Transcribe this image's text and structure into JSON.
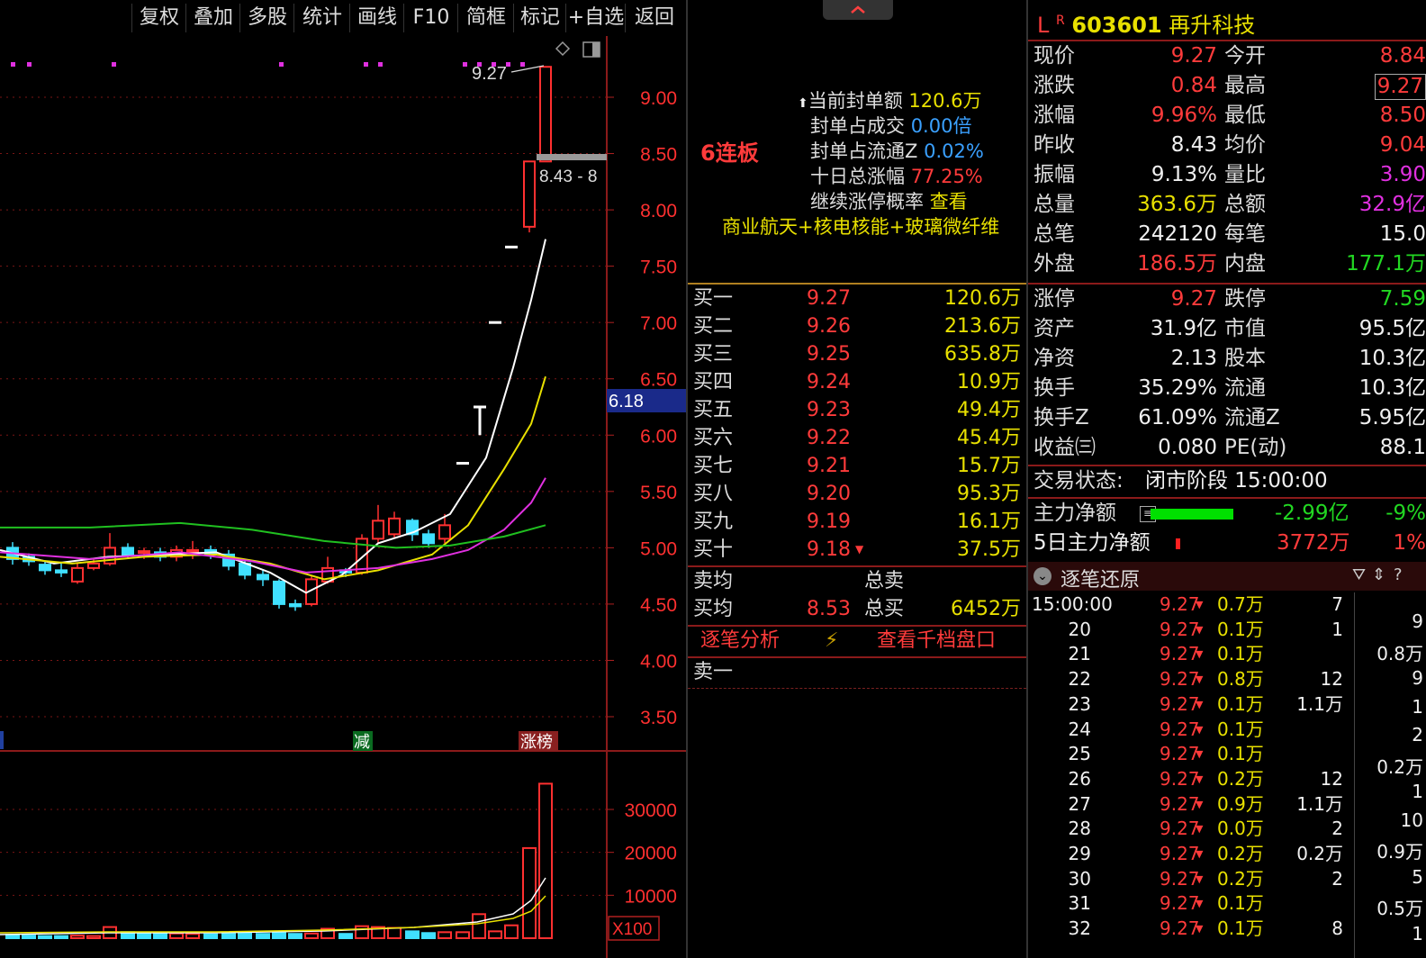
{
  "toolbar": {
    "buttons": [
      "复权",
      "叠加",
      "多股",
      "统计",
      "画线",
      "F10",
      "简框",
      "标记",
      "+自选",
      "返回"
    ]
  },
  "chart": {
    "price_labels": [
      "9.00",
      "8.50",
      "8.00",
      "7.50",
      "7.00",
      "6.50",
      "6.00",
      "5.50",
      "5.00",
      "4.50",
      "4.00",
      "3.50"
    ],
    "high_marker": "9.27",
    "range_tag": "8.43 - 8",
    "current_price_tag": "6.18",
    "badge_reduce": "减",
    "badge_rank": "涨榜",
    "volume_labels": [
      "30000",
      "20000",
      "10000"
    ],
    "volume_unit": "X100",
    "colors": {
      "up": "#ff3030",
      "down": "#40e0ff",
      "ma5": "#ffffff",
      "ma10": "#e8e000",
      "ma20": "#e030e0",
      "ma60": "#20c020"
    }
  },
  "chart_data": {
    "type": "candlestick",
    "price_axis": [
      3.5,
      9.0
    ],
    "volume_axis": [
      0,
      30000
    ],
    "volume_unit": "X100",
    "last_candles": [
      {
        "open": 7.85,
        "close": 8.43,
        "high": 8.43,
        "low": 7.85
      },
      {
        "open": 8.43,
        "close": 9.27,
        "high": 9.27,
        "low": 8.43
      }
    ]
  },
  "board": {
    "streak": "6连板",
    "seal_amount_label": "当前封单额",
    "seal_amount": "120.6万",
    "seal_vs_turnover_label": "封单占成交",
    "seal_vs_turnover": "0.00倍",
    "seal_vs_float_label": "封单占流通Z",
    "seal_vs_float": "0.02%",
    "ten_day_label": "十日总涨幅",
    "ten_day": "77.25%",
    "continue_label": "继续涨停概率",
    "continue_link": "查看",
    "concepts": "商业航天+核电核能+玻璃微纤维"
  },
  "order_book": {
    "bids": [
      {
        "label": "买一",
        "price": "9.27",
        "vol": "120.6万"
      },
      {
        "label": "买二",
        "price": "9.26",
        "vol": "213.6万"
      },
      {
        "label": "买三",
        "price": "9.25",
        "vol": "635.8万"
      },
      {
        "label": "买四",
        "price": "9.24",
        "vol": "10.9万"
      },
      {
        "label": "买五",
        "price": "9.23",
        "vol": "49.4万"
      },
      {
        "label": "买六",
        "price": "9.22",
        "vol": "45.4万"
      },
      {
        "label": "买七",
        "price": "9.21",
        "vol": "15.7万"
      },
      {
        "label": "买八",
        "price": "9.20",
        "vol": "95.3万"
      },
      {
        "label": "买九",
        "price": "9.19",
        "vol": "16.1万"
      },
      {
        "label": "买十",
        "price": "9.18",
        "vol": "37.5万"
      }
    ],
    "sell_avg_label": "卖均",
    "total_sell_label": "总卖",
    "buy_avg_label": "买均",
    "buy_avg": "8.53",
    "total_buy_label": "总买",
    "total_buy": "6452万",
    "tick_analysis": "逐笔分析",
    "thousand_levels": "查看千档盘口",
    "ask_one": "卖一"
  },
  "quote": {
    "flag_l": "L",
    "flag_r": "R",
    "code": "603601",
    "name": "再升科技",
    "rows": [
      {
        "l1": "现价",
        "v1": "9.27",
        "l2": "今开",
        "v2": "8.84"
      },
      {
        "l1": "涨跌",
        "v1": "0.84",
        "l2": "最高",
        "v2": "9.27"
      },
      {
        "l1": "涨幅",
        "v1": "9.96%",
        "l2": "最低",
        "v2": "8.50"
      },
      {
        "l1": "昨收",
        "v1": "8.43",
        "l2": "均价",
        "v2": "9.04"
      },
      {
        "l1": "振幅",
        "v1": "9.13%",
        "l2": "量比",
        "v2": "3.90"
      },
      {
        "l1": "总量",
        "v1": "363.6万",
        "l2": "总额",
        "v2": "32.9亿"
      },
      {
        "l1": "总笔",
        "v1": "242120",
        "l2": "每笔",
        "v2": "15.0"
      },
      {
        "l1": "外盘",
        "v1": "186.5万",
        "l2": "内盘",
        "v2": "177.1万"
      }
    ],
    "rows2": [
      {
        "l1": "涨停",
        "v1": "9.27",
        "l2": "跌停",
        "v2": "7.59"
      },
      {
        "l1": "资产",
        "v1": "31.9亿",
        "l2": "市值",
        "v2": "95.5亿"
      },
      {
        "l1": "净资",
        "v1": "2.13",
        "l2": "股本",
        "v2": "10.3亿"
      },
      {
        "l1": "换手",
        "v1": "35.29%",
        "l2": "流通",
        "v2": "10.3亿"
      },
      {
        "l1": "换手Z",
        "v1": "61.09%",
        "l2": "流通Z",
        "v2": "5.95亿"
      },
      {
        "l1": "收益㈢",
        "v1": "0.080",
        "l2": "PE(动)",
        "v2": "88.1"
      }
    ],
    "status_label": "交易状态:",
    "status_value": "闭市阶段 15:00:00",
    "main_net_label": "主力净额",
    "main_net_value": "-2.99亿",
    "main_net_pct": "-9%",
    "five_day_label": "5日主力净额",
    "five_day_value": "3772万",
    "five_day_pct": "1%",
    "ticks_title": "逐笔还原"
  },
  "ticks": [
    {
      "time": "15:00:00",
      "price": "9.27",
      "vol": "0.7万",
      "n": "7"
    },
    {
      "time": "20",
      "price": "9.27",
      "vol": "0.1万",
      "n": "1"
    },
    {
      "time": "21",
      "price": "9.27",
      "vol": "0.1万",
      "n": ""
    },
    {
      "time": "22",
      "price": "9.27",
      "vol": "0.8万",
      "n": "12"
    },
    {
      "time": "23",
      "price": "9.27",
      "vol": "0.1万",
      "n": "1.1万"
    },
    {
      "time": "24",
      "price": "9.27",
      "vol": "0.1万",
      "n": ""
    },
    {
      "time": "25",
      "price": "9.27",
      "vol": "0.1万",
      "n": ""
    },
    {
      "time": "26",
      "price": "9.27",
      "vol": "0.2万",
      "n": "12"
    },
    {
      "time": "27",
      "price": "9.27",
      "vol": "0.9万",
      "n": "1.1万"
    },
    {
      "time": "28",
      "price": "9.27",
      "vol": "0.0万",
      "n": "2"
    },
    {
      "time": "29",
      "price": "9.27",
      "vol": "0.2万",
      "n": "0.2万"
    },
    {
      "time": "30",
      "price": "9.27",
      "vol": "0.2万",
      "n": "2"
    },
    {
      "time": "31",
      "price": "9.27",
      "vol": "0.1万",
      "n": ""
    },
    {
      "time": "32",
      "price": "9.27",
      "vol": "0.1万",
      "n": "8"
    }
  ],
  "tick_side": [
    "9",
    "0.8万",
    "9",
    "1",
    "2",
    "0.2万",
    "1",
    "10",
    "0.9万",
    "5",
    "0.5万",
    "1"
  ]
}
